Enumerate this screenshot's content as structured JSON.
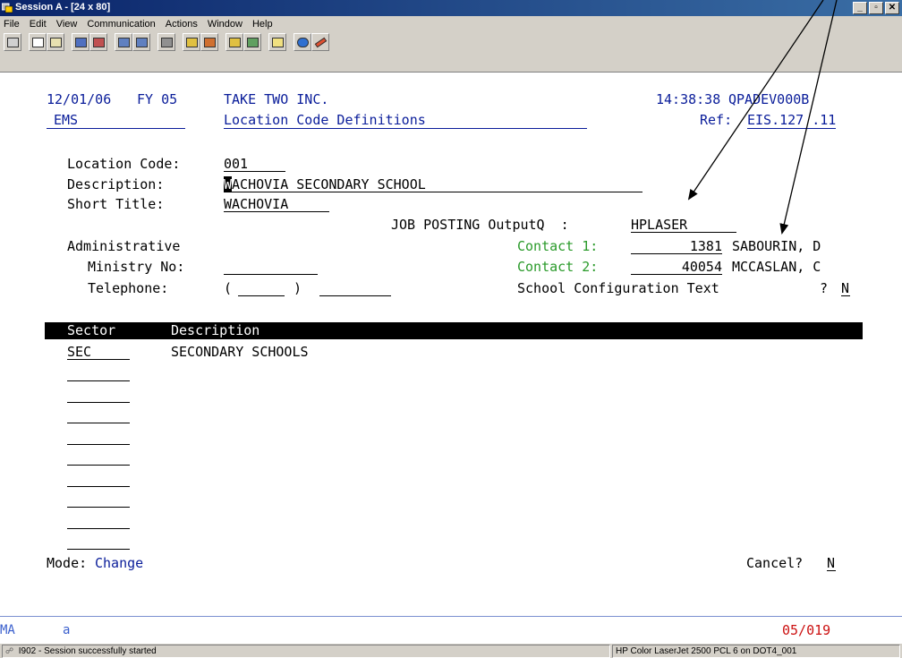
{
  "window": {
    "title": "Session A - [24 x 80]",
    "controls": {
      "minimize": "_",
      "maximize": "▫",
      "close": "✕"
    }
  },
  "menu": [
    "File",
    "Edit",
    "View",
    "Communication",
    "Actions",
    "Window",
    "Help"
  ],
  "toolbar_icons": [
    "display-icon",
    "copy-icon",
    "paste-icon",
    "send-icon",
    "receive-icon",
    "macro-record-icon",
    "macro-play-icon",
    "print-screen-icon",
    "keyboard-map-icon",
    "color-map-icon",
    "transfer-send-icon",
    "transfer-receive-icon",
    "clipboard-icon",
    "globe-icon",
    "pencil-icon"
  ],
  "header": {
    "date": "12/01/06",
    "fy": "FY 05",
    "company": "TAKE TWO INC.",
    "time": "14:38:38",
    "device": "QPADEV000B",
    "module": "EMS",
    "screen_title": "Location Code Definitions",
    "ref_label": "Ref:",
    "ref_value": "EIS.127 .11"
  },
  "form": {
    "location_code_label": "Location Code:",
    "location_code": "001",
    "description_label": "Description:",
    "description_cursor": "W",
    "description_rest": "ACHOVIA SECONDARY SCHOOL",
    "short_title_label": "Short Title:",
    "short_title": "WACHOVIA",
    "job_posting_label": "JOB POSTING OutputQ  :",
    "job_posting_value": "HPLASER",
    "administrative_label": "Administrative",
    "ministry_label": "Ministry No:",
    "ministry_value": "",
    "telephone_label": "Telephone:",
    "telephone_open": "(",
    "telephone_close": ")",
    "contact1_label": "Contact 1:",
    "contact1_id": "1381",
    "contact1_name": "SABOURIN, D",
    "contact2_label": "Contact 2:",
    "contact2_id": "40054",
    "contact2_name": "MCCASLAN, C",
    "config_label": "School Configuration Text",
    "config_q": "?",
    "config_value": "N"
  },
  "sector_table": {
    "headers": [
      "Sector",
      "Description"
    ],
    "rows": [
      {
        "sector": "SEC",
        "description": "SECONDARY SCHOOLS"
      },
      {
        "sector": "",
        "description": ""
      },
      {
        "sector": "",
        "description": ""
      },
      {
        "sector": "",
        "description": ""
      },
      {
        "sector": "",
        "description": ""
      },
      {
        "sector": "",
        "description": ""
      },
      {
        "sector": "",
        "description": ""
      },
      {
        "sector": "",
        "description": ""
      },
      {
        "sector": "",
        "description": ""
      },
      {
        "sector": "",
        "description": ""
      }
    ]
  },
  "footer": {
    "mode_label": "Mode:",
    "mode_value": "Change",
    "cancel_label": "Cancel?",
    "cancel_value": "N"
  },
  "oia": {
    "indicator": "MA",
    "input_char": "a",
    "cursor_pos": "05/019"
  },
  "status": {
    "message": "I902 - Session successfully started",
    "printer": "HP Color LaserJet 2500 PCL 6 on DOT4_001"
  },
  "colors": {
    "field_blue": "#0a1d9a",
    "label_green": "#2a9a2a",
    "oia_red": "#cc1111",
    "titlebar": "#0a246a"
  }
}
